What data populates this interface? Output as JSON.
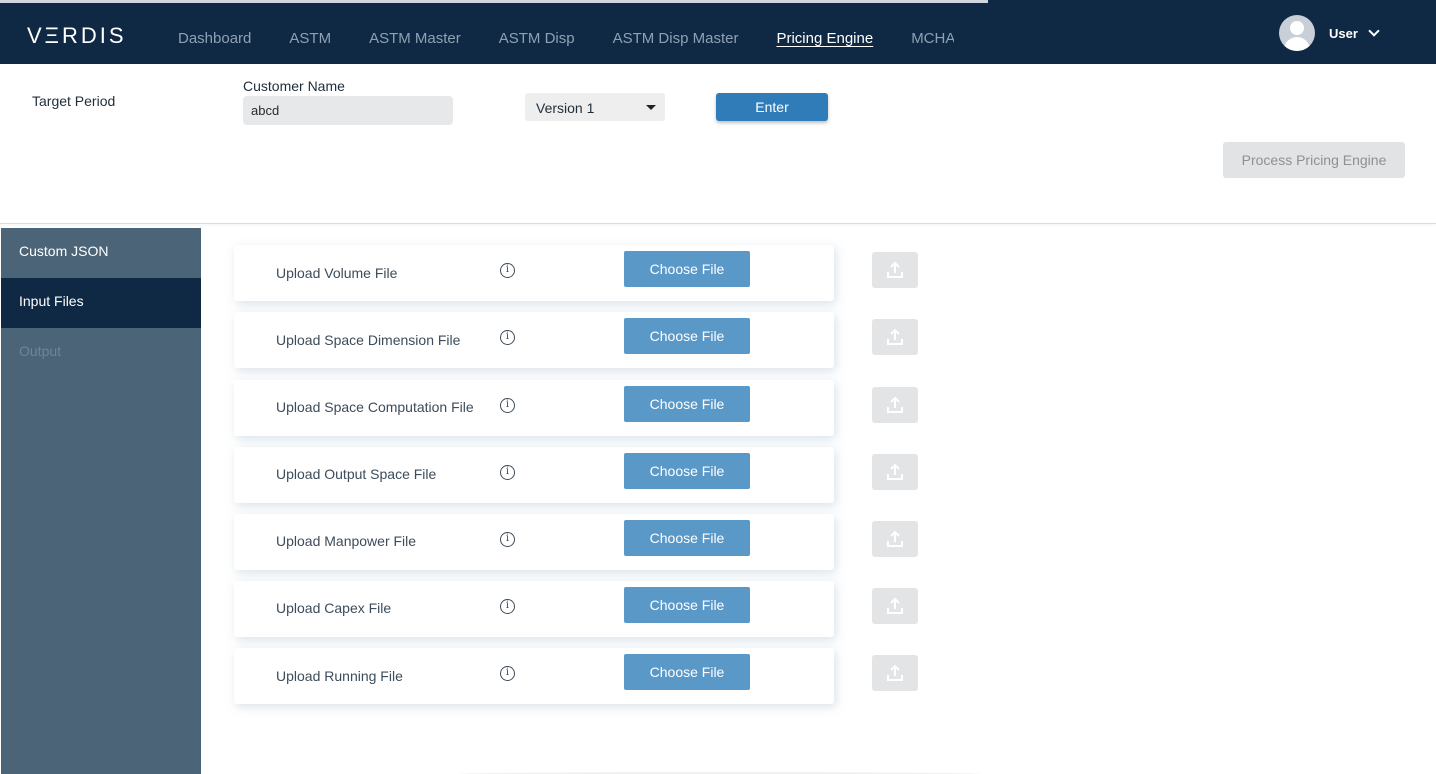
{
  "header": {
    "logo": "VΞRDIS",
    "nav": [
      "Dashboard",
      "ASTM",
      "ASTM Master",
      "ASTM Disp",
      "ASTM Disp Master",
      "Pricing Engine",
      "MCHA"
    ],
    "active_nav": "Pricing Engine",
    "user_label": "User"
  },
  "filters": {
    "target_period_label": "Target Period",
    "customer_name_label": "Customer Name",
    "customer_name_value": "abcd",
    "version_selected": "Version 1",
    "enter_label": "Enter",
    "process_label": "Process Pricing Engine"
  },
  "sidebar": {
    "items": [
      {
        "label": "Custom JSON",
        "state": "normal"
      },
      {
        "label": "Input Files",
        "state": "active"
      },
      {
        "label": "Output",
        "state": "disabled"
      }
    ]
  },
  "uploads": [
    {
      "label": "Upload Volume File",
      "button": "Choose File"
    },
    {
      "label": "Upload Space Dimension File",
      "button": "Choose File"
    },
    {
      "label": "Upload Space Computation File",
      "button": "Choose File"
    },
    {
      "label": "Upload Output Space File",
      "button": "Choose File"
    },
    {
      "label": "Upload Manpower File",
      "button": "Choose File"
    },
    {
      "label": "Upload Capex File",
      "button": "Choose File"
    },
    {
      "label": "Upload Running File",
      "button": "Choose File"
    }
  ],
  "colors": {
    "navbar": "#0f2944",
    "sidebar": "#4b6478",
    "primary_button": "#2f7cb8",
    "choose_button": "#5a98c8"
  }
}
